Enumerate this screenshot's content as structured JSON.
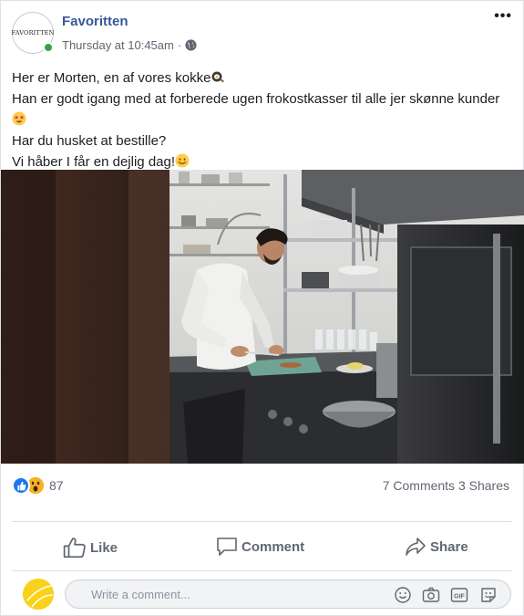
{
  "post": {
    "page_name": "Favoritten",
    "avatar_text": "FAVORITTEN",
    "timestamp": "Thursday at 10:45am",
    "separator": "·",
    "more_icon": "more-dots-icon",
    "lines": [
      "Her er Morten, en af vores kokke",
      "Han er godt igang med at forberede ugen frokostkasser til alle jer skønne kunder",
      "Har du husket at bestille?",
      "Vi håber I får en dejlig dag!"
    ],
    "emojis": [
      "frying-pan-emoji",
      "star-struck-emoji",
      "smiling-emoji"
    ]
  },
  "stats": {
    "reaction_icons": [
      "like-reaction-icon",
      "wow-reaction-icon"
    ],
    "reaction_count": "87",
    "comments": "7 Comments",
    "shares": "3 Shares"
  },
  "actions": {
    "like": "Like",
    "comment": "Comment",
    "share": "Share"
  },
  "composer": {
    "placeholder": "Write a comment...",
    "icons": [
      "emoji-icon",
      "camera-icon",
      "gif-icon",
      "sticker-icon"
    ]
  },
  "colors": {
    "link_blue": "#385898",
    "like_blue": "#1877f2",
    "wow_yellow": "#f7b125",
    "online_green": "#31a24c",
    "secondary_text": "#606770"
  }
}
